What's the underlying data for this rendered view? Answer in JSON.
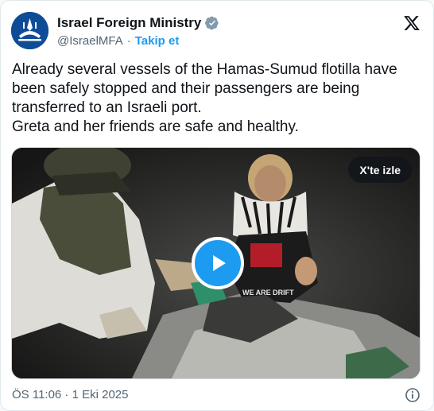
{
  "account": {
    "display_name": "Israel Foreign Ministry",
    "handle": "@IsraelMFA",
    "separator": "·",
    "follow_label": "Takip et",
    "verified_icon": "verified-badge-icon",
    "platform_icon": "x-logo-icon"
  },
  "tweet": {
    "lines": [
      "Already several vessels of the Hamas-Sumud flotilla have",
      "been safely stopped and their passengers are being",
      "transferred to an Israeli port.",
      "Greta and her friends are safe and healthy."
    ]
  },
  "media": {
    "watch_label": "X'te izle",
    "play_icon": "play-icon",
    "scene_text": "WE ARE DRIFT"
  },
  "footer": {
    "timestamp": "ÖS 11:06 · 1 Eki 2025",
    "info_icon": "info-icon"
  },
  "colors": {
    "accent": "#1d9bf0",
    "text_primary": "#0f1419",
    "text_secondary": "#536471",
    "avatar_bg": "#0f4c97"
  }
}
